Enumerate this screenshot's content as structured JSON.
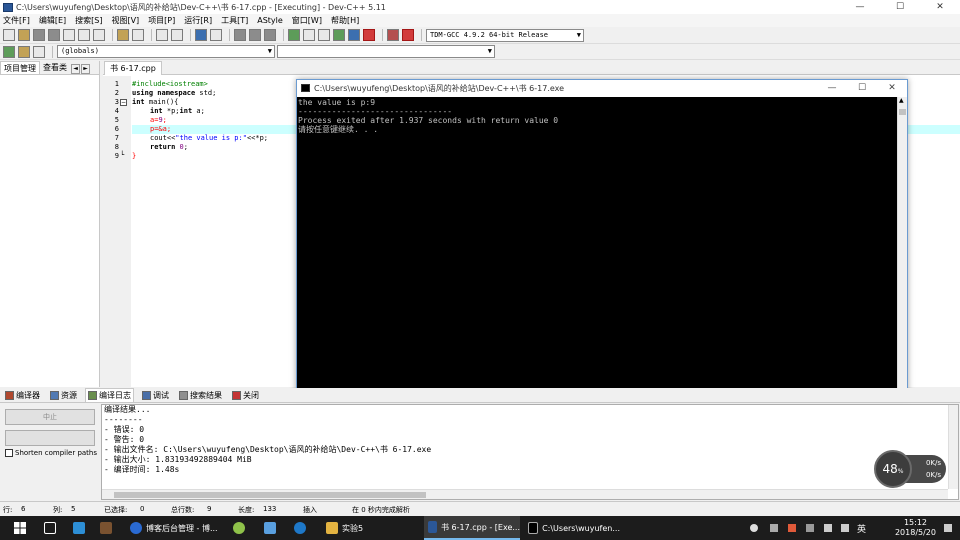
{
  "window": {
    "title": "C:\\Users\\wuyufeng\\Desktop\\语风的补给站\\Dev-C++\\书 6-17.cpp - [Executing] - Dev-C++ 5.11",
    "minimize": "—",
    "maximize": "☐",
    "close": "✕"
  },
  "menu": [
    "文件[F]",
    "编辑[E]",
    "搜索[S]",
    "视图[V]",
    "项目[P]",
    "运行[R]",
    "工具[T]",
    "AStyle",
    "窗口[W]",
    "帮助[H]"
  ],
  "toolbar": {
    "compiler_select": "TDM-GCC 4.9.2 64-bit Release",
    "scope_select": "(globals)"
  },
  "left_panel": {
    "tabs": [
      "项目管理",
      "查看类"
    ],
    "nav_prev": "◄",
    "nav_next": "►"
  },
  "editor": {
    "tab": "书 6-17.cpp",
    "line_numbers": [
      "1",
      "2",
      "3",
      "4",
      "5",
      "6",
      "7",
      "8",
      "9"
    ],
    "fold_mark": "−",
    "fold_end": "└",
    "code": {
      "l1": "#include<iostream>",
      "l2_kw": "using namespace",
      "l2_rest": " std;",
      "l3_kw": "int",
      "l3_rest": " main(){",
      "l4_kw": "int",
      "l4_a": " *p;",
      "l4_kw2": "int",
      "l4_b": " a;",
      "l5_a": "a=",
      "l5_num": "9",
      "l5_b": ";",
      "l6": "p=&a;",
      "l7_a": "cout<<",
      "l7_str": "\"the value is p:\"",
      "l7_b": "<<*p;",
      "l8_kw": "return",
      "l8_num": " 0",
      "l8_b": ";",
      "l9": "}"
    }
  },
  "console": {
    "title": "C:\\Users\\wuyufeng\\Desktop\\语风的补给站\\Dev-C++\\书 6-17.exe",
    "minimize": "—",
    "maximize": "☐",
    "close": "✕",
    "lines": [
      "the value is p:9",
      "--------------------------------",
      "Process exited after 1.937 seconds with return value 0",
      "请按任意键继续. . ."
    ]
  },
  "bottom_tabs": [
    "编译器",
    "资源",
    "编译日志",
    "调试",
    "搜索结果",
    "关闭"
  ],
  "bottom_panel": {
    "abort_button": "中止",
    "shorten_label": "Shorten compiler paths",
    "log_lines": [
      "编译结果...",
      "--------",
      "- 错误: 0",
      "- 警告: 0",
      "- 输出文件名: C:\\Users\\wuyufeng\\Desktop\\语风的补给站\\Dev-C++\\书 6-17.exe",
      "- 输出大小: 1.83193492889404 MiB",
      "- 编译时间: 1.48s"
    ]
  },
  "net_widget": {
    "percent": "48",
    "percent_unit": "%",
    "up_rate": "0K/s",
    "down_rate": "0K/s"
  },
  "status": {
    "row_label": "行:",
    "row_value": "6",
    "col_label": "列:",
    "col_value": "5",
    "sel_label": "已选择:",
    "sel_value": "0",
    "total_label": "总行数:",
    "total_value": "9",
    "len_label": "长度:",
    "len_value": "133",
    "mode": "插入",
    "parse": "在 0 秒内完成解析"
  },
  "taskbar": {
    "apps": [
      {
        "label": "博客后台管理 - 博...",
        "active": false
      },
      {
        "label": "实验5",
        "active": false
      },
      {
        "label": "书 6-17.cpp - [Exe...",
        "active": true
      },
      {
        "label": "C:\\Users\\wuyufen...",
        "active": false
      }
    ],
    "time": "15:12",
    "date": "2018/5/20",
    "ime": "英"
  }
}
